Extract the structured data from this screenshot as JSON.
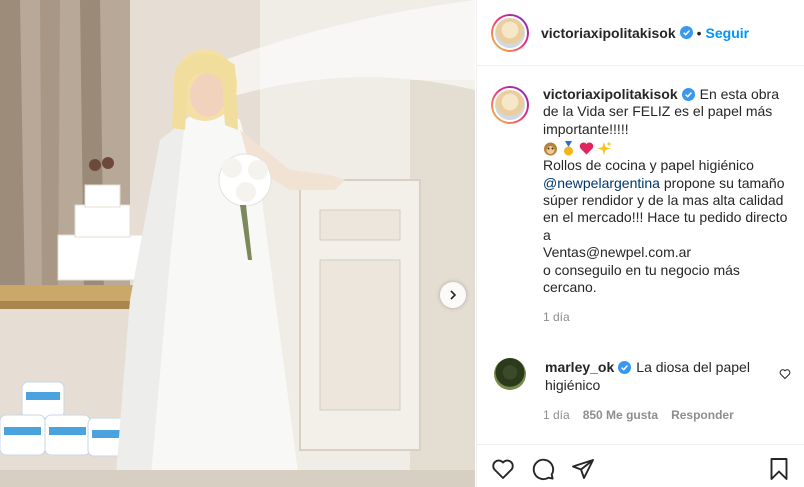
{
  "post": {
    "username": "victoriaxipolitakisok",
    "separator": "•",
    "follow_label": "Seguir"
  },
  "caption": {
    "username": "victoriaxipolitakisok",
    "text_intro": "En esta obra de la Vida ser FELIZ es el papel más importante!!!!!",
    "emojis": [
      "monkey-face-icon",
      "medal-icon",
      "red-heart-icon",
      "sparkles-icon"
    ],
    "line1": "Rollos de cocina y papel higiénico",
    "mention": "@newpelargentina",
    "after_mention": " propone su tamaño súper rendidor y de la mas alta calidad en el mercado!!! Hace tu pedido directo a",
    "email_line": "Ventas@newpel.com.ar",
    "last_line": "o conseguilo en tu negocio más cercano.",
    "time": "1 día"
  },
  "comment": {
    "username": "marley_ok",
    "text": "La diosa del papel higiénico",
    "time": "1 día",
    "likes": "850 Me gusta",
    "reply_label": "Responder"
  },
  "colors": {
    "accent_blue": "#0095f6",
    "mention_blue": "#00376b",
    "secondary_text": "#8e8e8e",
    "divider": "#efefef"
  }
}
